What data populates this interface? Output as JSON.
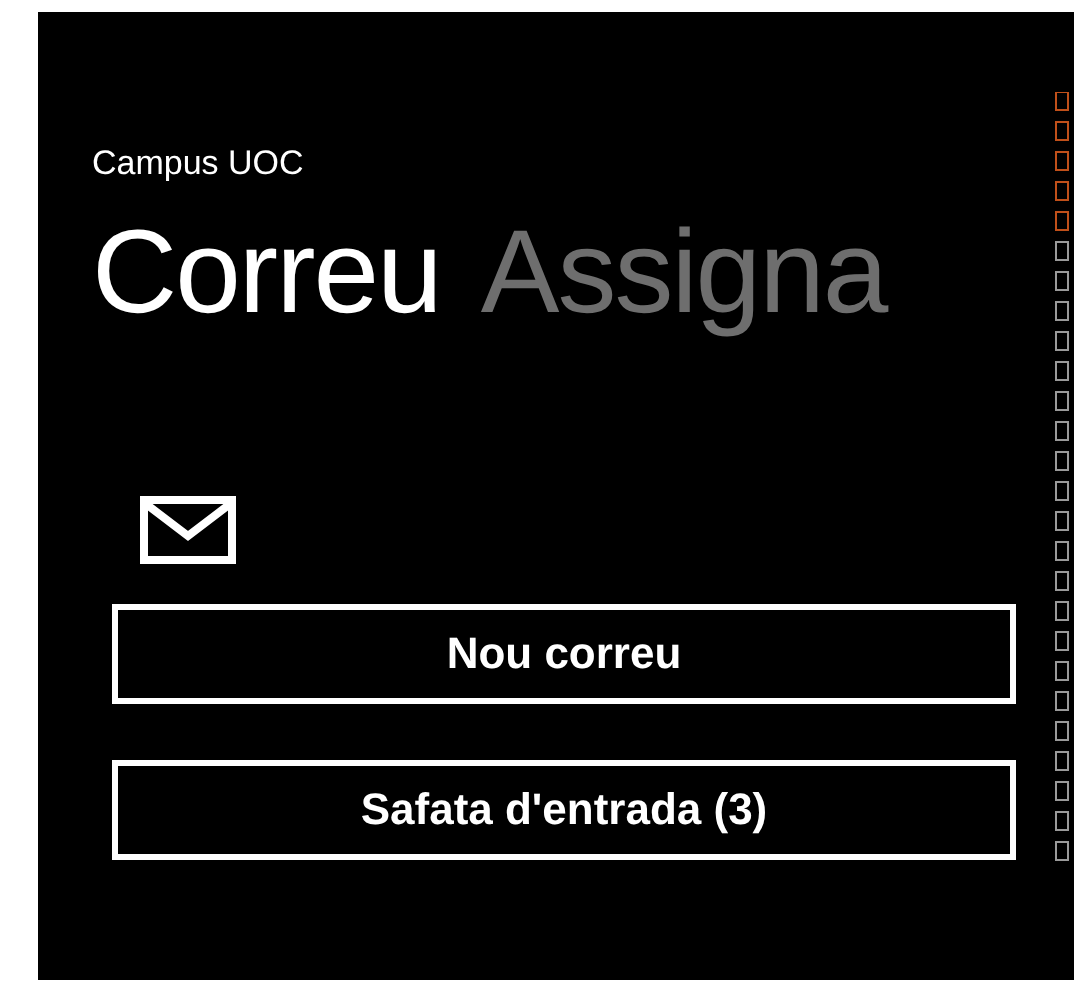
{
  "app_title": "Campus UOC",
  "pivot": [
    {
      "label": "Correu",
      "selected": true
    },
    {
      "label": "Assigna",
      "selected": false
    }
  ],
  "buttons": [
    {
      "label": "Nou correu"
    },
    {
      "label": "Safata d'entrada (3)"
    }
  ]
}
